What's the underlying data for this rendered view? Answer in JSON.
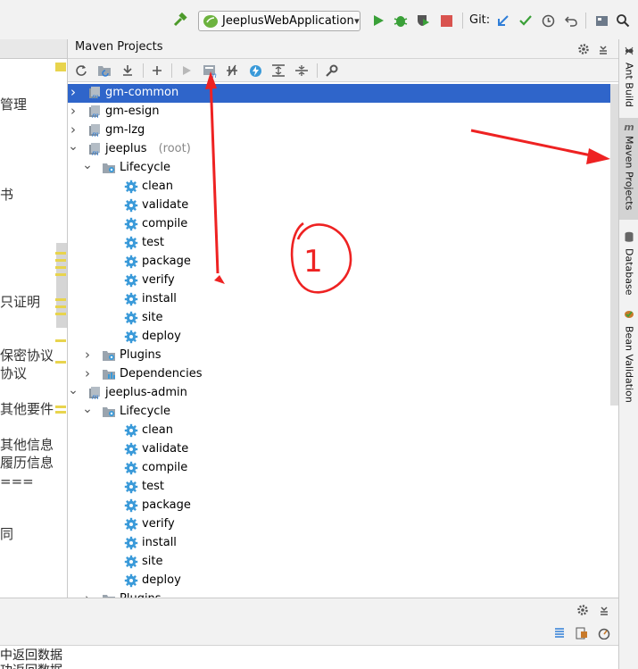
{
  "toolbar": {
    "run_config": "JeeplusWebApplication",
    "git_label": "Git:",
    "icons": [
      "hammer-icon",
      "run-icon",
      "debug-icon",
      "coverage-icon",
      "stop-icon",
      "vcs-update-icon",
      "vcs-commit-icon",
      "history-icon",
      "rollback-icon",
      "search-icon"
    ]
  },
  "left_editor": {
    "lines": [
      "管理",
      "书",
      "只证明",
      "保密协议",
      "协议",
      "其他要件",
      "其他信息",
      "履历信息",
      "===",
      "同"
    ]
  },
  "maven": {
    "title": "Maven Projects",
    "toolbar_icons": [
      "reimport-icon",
      "generate-sources-icon",
      "download-icon",
      "add-icon",
      "run-maven-build-icon",
      "execute-goal-icon",
      "toggle-offline-icon",
      "skip-tests-icon",
      "show-dependencies-icon",
      "collapse-all-icon",
      "maven-settings-icon"
    ],
    "tree": [
      {
        "label": "gm-common",
        "suffix": "",
        "type": "module",
        "level": 0,
        "arrow": "right",
        "selected": true
      },
      {
        "label": "gm-esign",
        "suffix": "",
        "type": "module",
        "level": 0,
        "arrow": "right"
      },
      {
        "label": "gm-lzg",
        "suffix": "",
        "type": "module",
        "level": 0,
        "arrow": "right"
      },
      {
        "label": "jeeplus",
        "suffix": "(root)",
        "type": "module",
        "level": 0,
        "arrow": "down"
      },
      {
        "label": "Lifecycle",
        "suffix": "",
        "type": "folder",
        "level": 1,
        "arrow": "down"
      },
      {
        "label": "clean",
        "suffix": "",
        "type": "goal",
        "level": 2
      },
      {
        "label": "validate",
        "suffix": "",
        "type": "goal",
        "level": 2
      },
      {
        "label": "compile",
        "suffix": "",
        "type": "goal",
        "level": 2
      },
      {
        "label": "test",
        "suffix": "",
        "type": "goal",
        "level": 2
      },
      {
        "label": "package",
        "suffix": "",
        "type": "goal",
        "level": 2
      },
      {
        "label": "verify",
        "suffix": "",
        "type": "goal",
        "level": 2
      },
      {
        "label": "install",
        "suffix": "",
        "type": "goal",
        "level": 2
      },
      {
        "label": "site",
        "suffix": "",
        "type": "goal",
        "level": 2
      },
      {
        "label": "deploy",
        "suffix": "",
        "type": "goal",
        "level": 2
      },
      {
        "label": "Plugins",
        "suffix": "",
        "type": "folder",
        "level": 1,
        "arrow": "right"
      },
      {
        "label": "Dependencies",
        "suffix": "",
        "type": "deps",
        "level": 1,
        "arrow": "right"
      },
      {
        "label": "jeeplus-admin",
        "suffix": "",
        "type": "module",
        "level": 0,
        "arrow": "down"
      },
      {
        "label": "Lifecycle",
        "suffix": "",
        "type": "folder",
        "level": 1,
        "arrow": "down"
      },
      {
        "label": "clean",
        "suffix": "",
        "type": "goal",
        "level": 2
      },
      {
        "label": "validate",
        "suffix": "",
        "type": "goal",
        "level": 2
      },
      {
        "label": "compile",
        "suffix": "",
        "type": "goal",
        "level": 2
      },
      {
        "label": "test",
        "suffix": "",
        "type": "goal",
        "level": 2
      },
      {
        "label": "package",
        "suffix": "",
        "type": "goal",
        "level": 2
      },
      {
        "label": "verify",
        "suffix": "",
        "type": "goal",
        "level": 2
      },
      {
        "label": "install",
        "suffix": "",
        "type": "goal",
        "level": 2
      },
      {
        "label": "site",
        "suffix": "",
        "type": "goal",
        "level": 2
      },
      {
        "label": "deploy",
        "suffix": "",
        "type": "goal",
        "level": 2
      },
      {
        "label": "Plugins",
        "suffix": "",
        "type": "folder",
        "level": 1,
        "arrow": "right"
      }
    ]
  },
  "right_tabs": [
    {
      "label": "Ant Build",
      "icon": "ant-icon",
      "active": false
    },
    {
      "label": "Maven Projects",
      "icon": "maven-icon",
      "active": true
    },
    {
      "label": "Database",
      "icon": "database-icon",
      "active": false
    },
    {
      "label": "Bean Validation",
      "icon": "bean-validation-icon",
      "active": false
    }
  ],
  "bottom": {
    "lines": [
      "中返回数据",
      "功返回数据"
    ]
  },
  "annotation": {
    "color": "#ee2222",
    "circled_label": "1"
  }
}
